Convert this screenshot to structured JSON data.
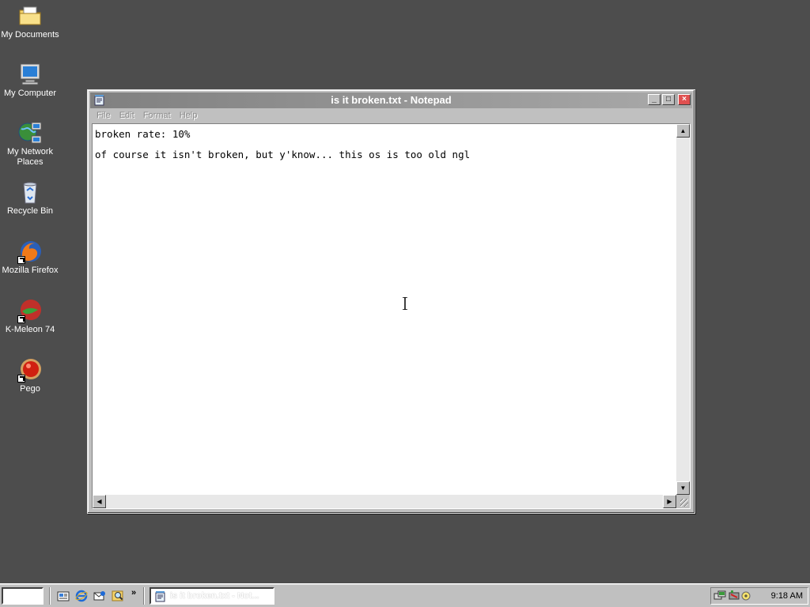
{
  "desktop": {
    "icons": [
      {
        "label": "My Documents"
      },
      {
        "label": "My Computer"
      },
      {
        "label": "My Network Places"
      },
      {
        "label": "Recycle Bin"
      },
      {
        "label": "Mozilla Firefox"
      },
      {
        "label": "K-Meleon 74"
      },
      {
        "label": "Pego"
      }
    ]
  },
  "window": {
    "title": "is it broken.txt - Notepad",
    "menu": [
      "File",
      "Edit",
      "Format",
      "Help"
    ],
    "content": "broken rate: 10%\nof course it isn't broken, but y'know... this os is too old ngl"
  },
  "taskbar": {
    "task_label": "is it broken.txt - Not...",
    "clock": "9:18 AM"
  },
  "colors": {
    "desktop_bg": "#4d4d4d",
    "titlebar_inactive": "#808080",
    "close_button": "#e05050"
  }
}
